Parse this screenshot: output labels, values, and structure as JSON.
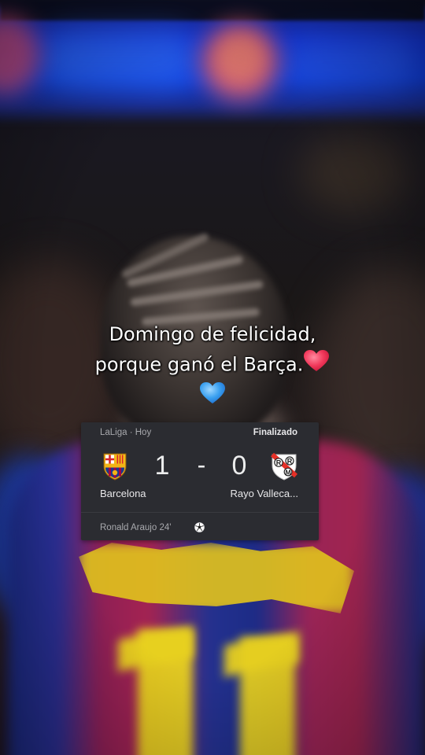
{
  "caption": {
    "line1": "Domingo de felicidad,",
    "line2": "porque ganó el Barça.",
    "emoji_red_heart": "red-heart-emoji",
    "emoji_blue_heart": "blue-heart-emoji"
  },
  "match_card": {
    "league": "LaLiga · Hoy",
    "status": "Finalizado",
    "home": {
      "name": "Barcelona",
      "score": "1",
      "crest": "fc-barcelona-crest-icon",
      "color": "#a50044"
    },
    "separator": "-",
    "away": {
      "name": "Rayo Valleca...",
      "score": "0",
      "crest": "rayo-vallecano-crest-icon",
      "color": "#e53027"
    },
    "scorer": "Ronald Araujo 24'",
    "goal_icon": "soccer-ball-icon"
  },
  "background": {
    "jersey_number": "11"
  }
}
